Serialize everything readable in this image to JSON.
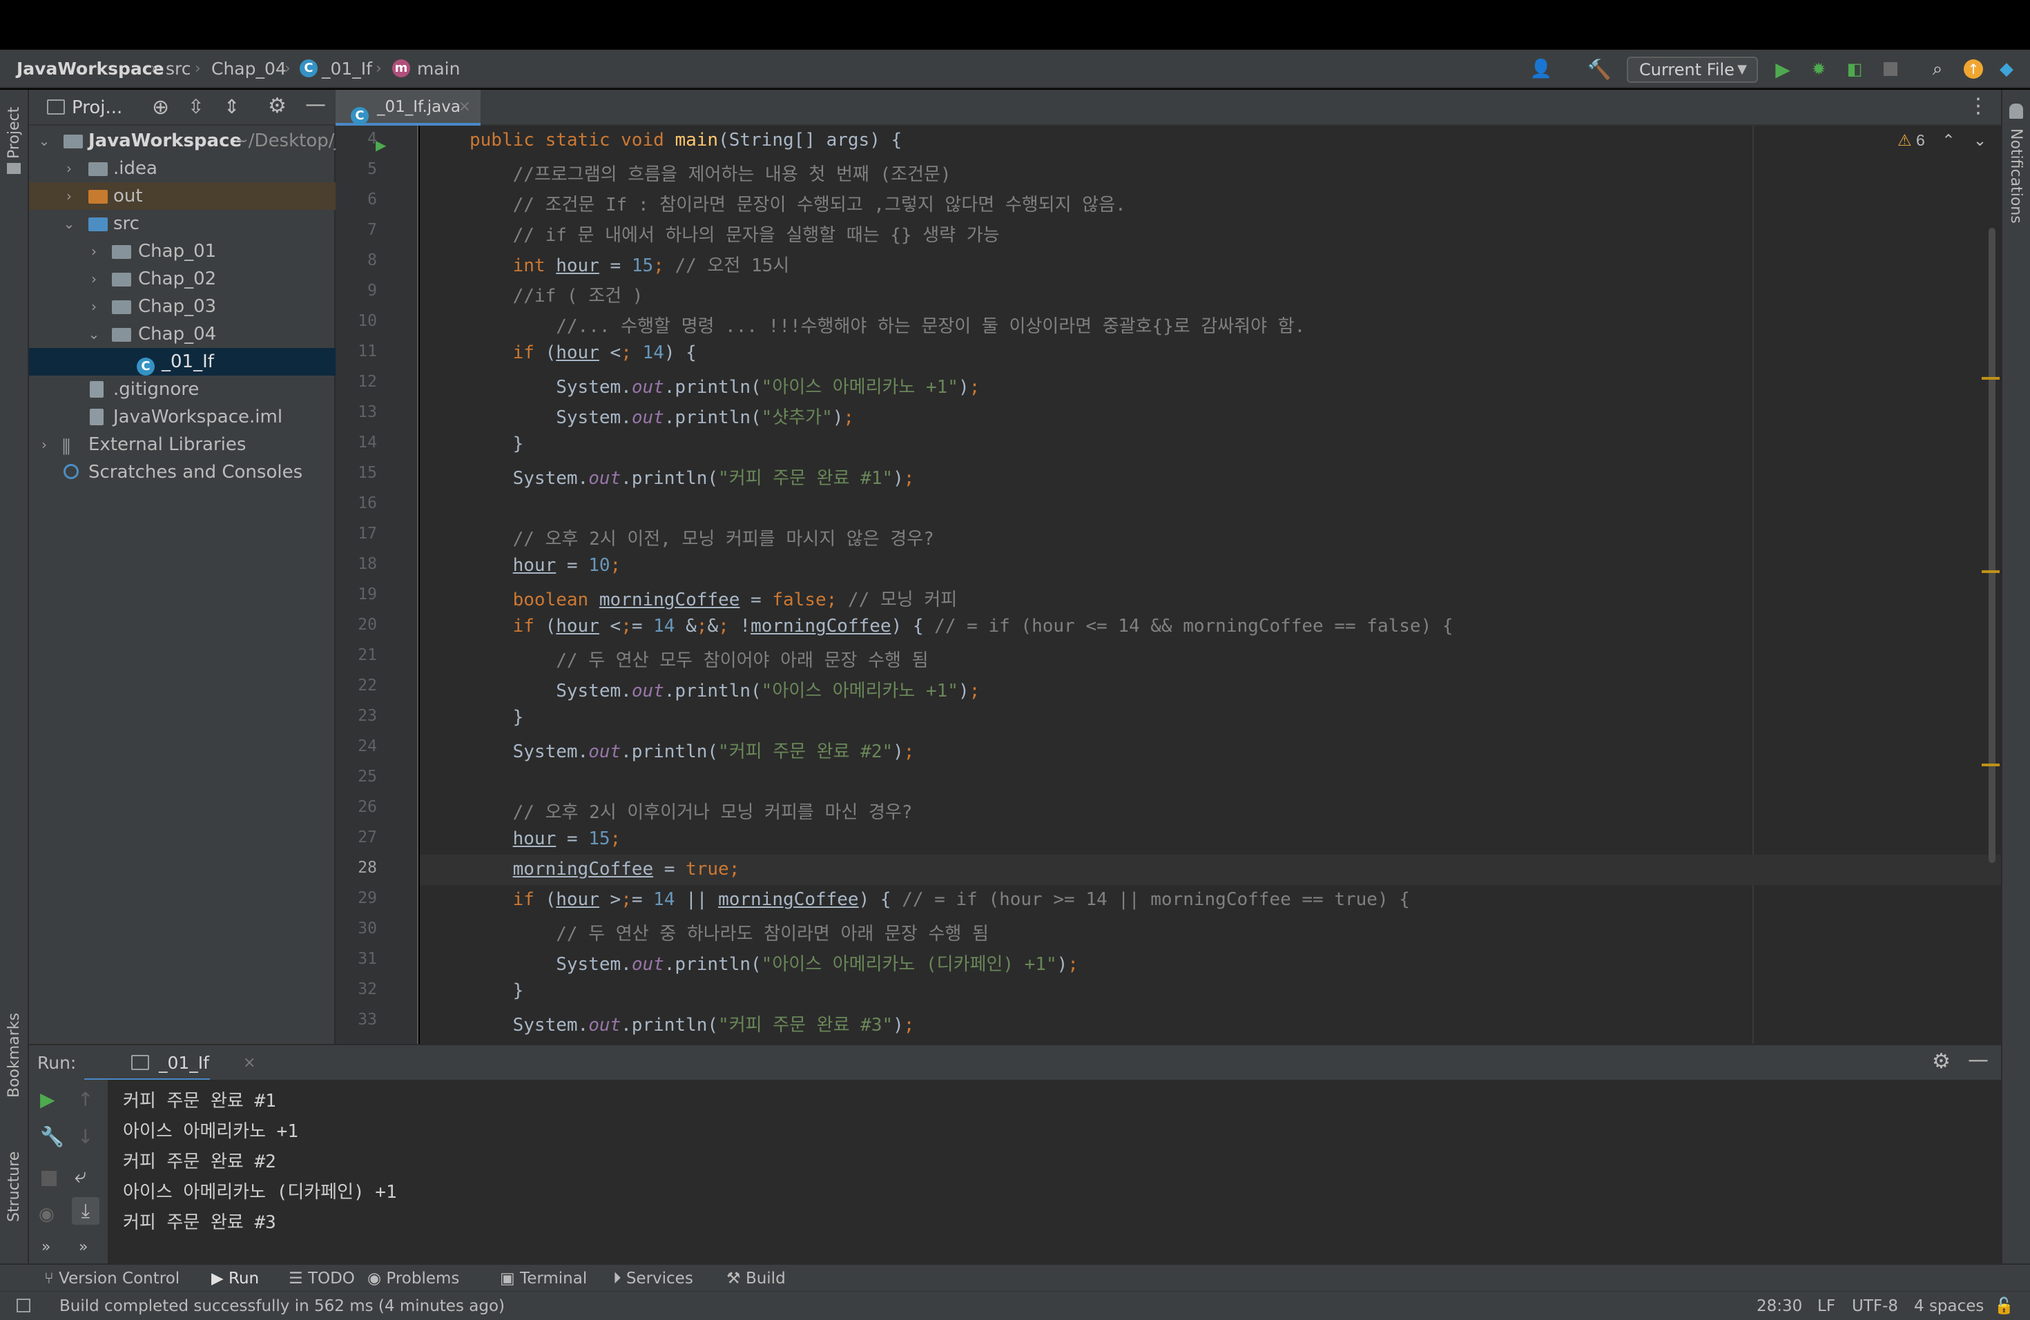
{
  "breadcrumb": {
    "project": "JavaWorkspace",
    "src": "src",
    "package": "Chap_04",
    "class": "_01_If",
    "method": "main"
  },
  "toolbar": {
    "run_config": "Current File",
    "icons": [
      "user-icon",
      "build-hammer-icon",
      "run-icon",
      "debug-icon",
      "coverage-icon",
      "stop-icon",
      "search-icon",
      "update-icon",
      "plugin-icon"
    ]
  },
  "left_stripe": {
    "project_tab": "Project",
    "bookmarks_tab": "Bookmarks",
    "structure_tab": "Structure"
  },
  "right_stripe": {
    "notifications_tab": "Notifications"
  },
  "project_panel": {
    "title": "Proj...",
    "tree": [
      {
        "label": "JavaWorkspace",
        "suffix": "~/Desktop/J",
        "depth": 0,
        "open": true
      },
      {
        "label": ".idea",
        "depth": 1,
        "open": false
      },
      {
        "label": "out",
        "depth": 1,
        "open": false
      },
      {
        "label": "src",
        "depth": 1,
        "open": true
      },
      {
        "label": "Chap_01",
        "depth": 2,
        "open": false
      },
      {
        "label": "Chap_02",
        "depth": 2,
        "open": false
      },
      {
        "label": "Chap_03",
        "depth": 2,
        "open": false
      },
      {
        "label": "Chap_04",
        "depth": 2,
        "open": true
      },
      {
        "label": "_01_If",
        "depth": 3
      },
      {
        "label": ".gitignore",
        "depth": 1
      },
      {
        "label": "JavaWorkspace.iml",
        "depth": 1
      },
      {
        "label": "External Libraries",
        "depth": 0,
        "open": false
      },
      {
        "label": "Scratches and Consoles",
        "depth": 0
      }
    ]
  },
  "editor": {
    "tab_label": "_01_If.java",
    "warnings_count": "6",
    "current_line": "28",
    "lines": [
      {
        "n": "4",
        "text": "public static void main(String[] args) {"
      },
      {
        "n": "5",
        "text": "//프로그램의 흐름을 제어하는 내용 첫 번째 (조건문)"
      },
      {
        "n": "6",
        "text": "// 조건문 If : 참이라면 문장이 수행되고 ,그렇지 않다면 수행되지 않음."
      },
      {
        "n": "7",
        "text": "// if 문 내에서 하나의 문자을 실행할 때는 {} 생략 가능"
      },
      {
        "n": "8",
        "text": "int hour = 15; // 오전 15시"
      },
      {
        "n": "9",
        "text": "//if ( 조건 )"
      },
      {
        "n": "10",
        "text": "//... 수행할 명령 ... !!!수행해야 하는 문장이 둘 이상이라면 중괄호{}로 감싸줘야 함."
      },
      {
        "n": "11",
        "text": "if (hour < 14) {"
      },
      {
        "n": "12",
        "text": "System.out.println(\"아이스 아메리카노 +1\");"
      },
      {
        "n": "13",
        "text": "System.out.println(\"샷추가\");"
      },
      {
        "n": "14",
        "text": "}"
      },
      {
        "n": "15",
        "text": "System.out.println(\"커피 주문 완료 #1\");"
      },
      {
        "n": "16",
        "text": ""
      },
      {
        "n": "17",
        "text": "// 오후 2시 이전, 모닝 커피를 마시지 않은 경우?"
      },
      {
        "n": "18",
        "text": "hour = 10;"
      },
      {
        "n": "19",
        "text": "boolean morningCoffee = false; // 모닝 커피"
      },
      {
        "n": "20",
        "text": "if (hour <= 14 && !morningCoffee) { // = if (hour <= 14 && morningCoffee == false) {"
      },
      {
        "n": "21",
        "text": "// 두 연산 모두 참이어야 아래 문장 수행 됨"
      },
      {
        "n": "22",
        "text": "System.out.println(\"아이스 아메리카노 +1\");"
      },
      {
        "n": "23",
        "text": "}"
      },
      {
        "n": "24",
        "text": "System.out.println(\"커피 주문 완료 #2\");"
      },
      {
        "n": "25",
        "text": ""
      },
      {
        "n": "26",
        "text": "// 오후 2시 이후이거나 모닝 커피를 마신 경우?"
      },
      {
        "n": "27",
        "text": "hour = 15;"
      },
      {
        "n": "28",
        "text": "morningCoffee = true;"
      },
      {
        "n": "29",
        "text": "if (hour >= 14 || morningCoffee) { // = if (hour >= 14 || morningCoffee == true) {"
      },
      {
        "n": "30",
        "text": "// 두 연산 중 하나라도 참이라면 아래 문장 수행 됨"
      },
      {
        "n": "31",
        "text": "System.out.println(\"아이스 아메리카노 (디카페인) +1\");"
      },
      {
        "n": "32",
        "text": "}"
      },
      {
        "n": "33",
        "text": "System.out.println(\"커피 주문 완료 #3\");"
      }
    ]
  },
  "run_panel": {
    "label": "Run:",
    "tab_label": "_01_If",
    "output": [
      "커피 주문 완료 #1",
      "아이스 아메리카노 +1",
      "커피 주문 완료 #2",
      "아이스 아메리카노 (디카페인) +1",
      "커피 주문 완료 #3"
    ]
  },
  "tool_strip": {
    "version_control": "Version Control",
    "run": "Run",
    "todo": "TODO",
    "problems": "Problems",
    "terminal": "Terminal",
    "services": "Services",
    "build": "Build"
  },
  "status": {
    "message": "Build completed successfully in 562 ms (4 minutes ago)",
    "position": "28:30",
    "line_sep": "LF",
    "encoding": "UTF-8",
    "indent": "4 spaces"
  },
  "colors": {
    "keyword": "#cc7832",
    "string": "#6a8759",
    "number": "#6897bb",
    "comment": "#808080",
    "method": "#ffc66d",
    "field": "#9876aa",
    "selection": "#0d293e"
  }
}
